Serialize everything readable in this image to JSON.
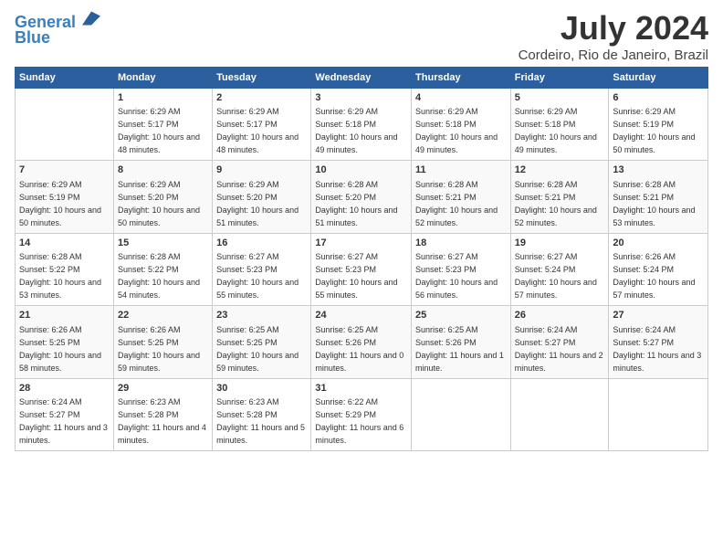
{
  "header": {
    "logo_line1": "General",
    "logo_line2": "Blue",
    "month_year": "July 2024",
    "location": "Cordeiro, Rio de Janeiro, Brazil"
  },
  "days_of_week": [
    "Sunday",
    "Monday",
    "Tuesday",
    "Wednesday",
    "Thursday",
    "Friday",
    "Saturday"
  ],
  "weeks": [
    [
      {
        "day": "",
        "sunrise": "",
        "sunset": "",
        "daylight": ""
      },
      {
        "day": "1",
        "sunrise": "Sunrise: 6:29 AM",
        "sunset": "Sunset: 5:17 PM",
        "daylight": "Daylight: 10 hours and 48 minutes."
      },
      {
        "day": "2",
        "sunrise": "Sunrise: 6:29 AM",
        "sunset": "Sunset: 5:17 PM",
        "daylight": "Daylight: 10 hours and 48 minutes."
      },
      {
        "day": "3",
        "sunrise": "Sunrise: 6:29 AM",
        "sunset": "Sunset: 5:18 PM",
        "daylight": "Daylight: 10 hours and 49 minutes."
      },
      {
        "day": "4",
        "sunrise": "Sunrise: 6:29 AM",
        "sunset": "Sunset: 5:18 PM",
        "daylight": "Daylight: 10 hours and 49 minutes."
      },
      {
        "day": "5",
        "sunrise": "Sunrise: 6:29 AM",
        "sunset": "Sunset: 5:18 PM",
        "daylight": "Daylight: 10 hours and 49 minutes."
      },
      {
        "day": "6",
        "sunrise": "Sunrise: 6:29 AM",
        "sunset": "Sunset: 5:19 PM",
        "daylight": "Daylight: 10 hours and 50 minutes."
      }
    ],
    [
      {
        "day": "7",
        "sunrise": "Sunrise: 6:29 AM",
        "sunset": "Sunset: 5:19 PM",
        "daylight": "Daylight: 10 hours and 50 minutes."
      },
      {
        "day": "8",
        "sunrise": "Sunrise: 6:29 AM",
        "sunset": "Sunset: 5:20 PM",
        "daylight": "Daylight: 10 hours and 50 minutes."
      },
      {
        "day": "9",
        "sunrise": "Sunrise: 6:29 AM",
        "sunset": "Sunset: 5:20 PM",
        "daylight": "Daylight: 10 hours and 51 minutes."
      },
      {
        "day": "10",
        "sunrise": "Sunrise: 6:28 AM",
        "sunset": "Sunset: 5:20 PM",
        "daylight": "Daylight: 10 hours and 51 minutes."
      },
      {
        "day": "11",
        "sunrise": "Sunrise: 6:28 AM",
        "sunset": "Sunset: 5:21 PM",
        "daylight": "Daylight: 10 hours and 52 minutes."
      },
      {
        "day": "12",
        "sunrise": "Sunrise: 6:28 AM",
        "sunset": "Sunset: 5:21 PM",
        "daylight": "Daylight: 10 hours and 52 minutes."
      },
      {
        "day": "13",
        "sunrise": "Sunrise: 6:28 AM",
        "sunset": "Sunset: 5:21 PM",
        "daylight": "Daylight: 10 hours and 53 minutes."
      }
    ],
    [
      {
        "day": "14",
        "sunrise": "Sunrise: 6:28 AM",
        "sunset": "Sunset: 5:22 PM",
        "daylight": "Daylight: 10 hours and 53 minutes."
      },
      {
        "day": "15",
        "sunrise": "Sunrise: 6:28 AM",
        "sunset": "Sunset: 5:22 PM",
        "daylight": "Daylight: 10 hours and 54 minutes."
      },
      {
        "day": "16",
        "sunrise": "Sunrise: 6:27 AM",
        "sunset": "Sunset: 5:23 PM",
        "daylight": "Daylight: 10 hours and 55 minutes."
      },
      {
        "day": "17",
        "sunrise": "Sunrise: 6:27 AM",
        "sunset": "Sunset: 5:23 PM",
        "daylight": "Daylight: 10 hours and 55 minutes."
      },
      {
        "day": "18",
        "sunrise": "Sunrise: 6:27 AM",
        "sunset": "Sunset: 5:23 PM",
        "daylight": "Daylight: 10 hours and 56 minutes."
      },
      {
        "day": "19",
        "sunrise": "Sunrise: 6:27 AM",
        "sunset": "Sunset: 5:24 PM",
        "daylight": "Daylight: 10 hours and 57 minutes."
      },
      {
        "day": "20",
        "sunrise": "Sunrise: 6:26 AM",
        "sunset": "Sunset: 5:24 PM",
        "daylight": "Daylight: 10 hours and 57 minutes."
      }
    ],
    [
      {
        "day": "21",
        "sunrise": "Sunrise: 6:26 AM",
        "sunset": "Sunset: 5:25 PM",
        "daylight": "Daylight: 10 hours and 58 minutes."
      },
      {
        "day": "22",
        "sunrise": "Sunrise: 6:26 AM",
        "sunset": "Sunset: 5:25 PM",
        "daylight": "Daylight: 10 hours and 59 minutes."
      },
      {
        "day": "23",
        "sunrise": "Sunrise: 6:25 AM",
        "sunset": "Sunset: 5:25 PM",
        "daylight": "Daylight: 10 hours and 59 minutes."
      },
      {
        "day": "24",
        "sunrise": "Sunrise: 6:25 AM",
        "sunset": "Sunset: 5:26 PM",
        "daylight": "Daylight: 11 hours and 0 minutes."
      },
      {
        "day": "25",
        "sunrise": "Sunrise: 6:25 AM",
        "sunset": "Sunset: 5:26 PM",
        "daylight": "Daylight: 11 hours and 1 minute."
      },
      {
        "day": "26",
        "sunrise": "Sunrise: 6:24 AM",
        "sunset": "Sunset: 5:27 PM",
        "daylight": "Daylight: 11 hours and 2 minutes."
      },
      {
        "day": "27",
        "sunrise": "Sunrise: 6:24 AM",
        "sunset": "Sunset: 5:27 PM",
        "daylight": "Daylight: 11 hours and 3 minutes."
      }
    ],
    [
      {
        "day": "28",
        "sunrise": "Sunrise: 6:24 AM",
        "sunset": "Sunset: 5:27 PM",
        "daylight": "Daylight: 11 hours and 3 minutes."
      },
      {
        "day": "29",
        "sunrise": "Sunrise: 6:23 AM",
        "sunset": "Sunset: 5:28 PM",
        "daylight": "Daylight: 11 hours and 4 minutes."
      },
      {
        "day": "30",
        "sunrise": "Sunrise: 6:23 AM",
        "sunset": "Sunset: 5:28 PM",
        "daylight": "Daylight: 11 hours and 5 minutes."
      },
      {
        "day": "31",
        "sunrise": "Sunrise: 6:22 AM",
        "sunset": "Sunset: 5:29 PM",
        "daylight": "Daylight: 11 hours and 6 minutes."
      },
      {
        "day": "",
        "sunrise": "",
        "sunset": "",
        "daylight": ""
      },
      {
        "day": "",
        "sunrise": "",
        "sunset": "",
        "daylight": ""
      },
      {
        "day": "",
        "sunrise": "",
        "sunset": "",
        "daylight": ""
      }
    ]
  ]
}
